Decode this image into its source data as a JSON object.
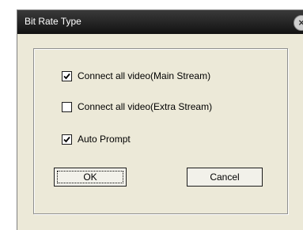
{
  "window": {
    "title": "Bit Rate Type",
    "close_symbol": "×"
  },
  "options": [
    {
      "label": "Connect all video(Main Stream)",
      "checked": true
    },
    {
      "label": "Connect all video(Extra Stream)",
      "checked": false
    },
    {
      "label": "Auto Prompt",
      "checked": true
    }
  ],
  "buttons": {
    "ok": "OK",
    "cancel": "Cancel"
  }
}
